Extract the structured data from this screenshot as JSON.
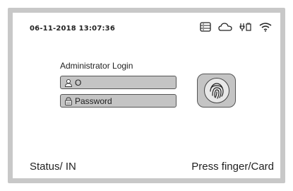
{
  "header": {
    "datetime": "06-11-2018  13:07:36",
    "icons": [
      "storage-icon",
      "cloud-icon",
      "network-plug-icon",
      "wifi-icon"
    ]
  },
  "login": {
    "title": "Administrator Login",
    "user_value": "O",
    "password_placeholder": "Password",
    "fingerprint_icon": "fingerprint-icon"
  },
  "footer": {
    "status": "Status/ IN",
    "prompt": "Press finger/Card"
  }
}
